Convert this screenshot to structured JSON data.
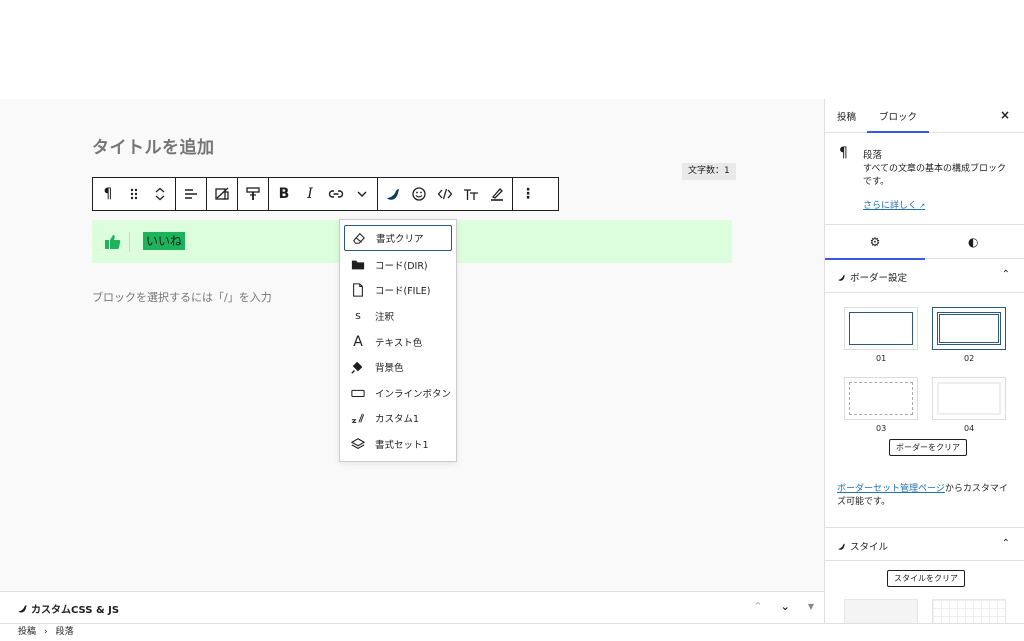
{
  "editor": {
    "title_placeholder": "タイトルを追加",
    "word_count": "文字数：1",
    "block_text": "いいね",
    "paragraph_placeholder": "ブロックを選択するには「/」を入力"
  },
  "toolbar": {
    "icons": [
      "paragraph-icon",
      "drag-handle-icon",
      "move-up-down-icon",
      "align-icon",
      "image-toggle-icon",
      "paint-roller-icon",
      "bold-icon",
      "italic-icon",
      "link-icon",
      "chevron-down-icon",
      "brand-icon",
      "emoji-icon",
      "code-icon",
      "text-size-icon",
      "highlighter-icon",
      "more-options-icon"
    ],
    "bold_label": "B",
    "italic_label": "I",
    "more_label": "⋮"
  },
  "format_menu": {
    "items": [
      {
        "label": "書式クリア",
        "icon": "eraser-icon"
      },
      {
        "label": "コード(DIR)",
        "icon": "folder-icon"
      },
      {
        "label": "コード(FILE)",
        "icon": "file-icon"
      },
      {
        "label": "注釈",
        "icon": "s-icon"
      },
      {
        "label": "テキスト色",
        "icon": "text-color-icon"
      },
      {
        "label": "背景色",
        "icon": "fill-icon"
      },
      {
        "label": "インラインボタン",
        "icon": "button-icon"
      },
      {
        "label": "カスタム1",
        "icon": "custom-icon"
      },
      {
        "label": "書式セット1",
        "icon": "layers-icon"
      }
    ],
    "s_glyph": "s",
    "a_glyph": "A"
  },
  "bottom_panel": {
    "title": "カスタムCSS & JS"
  },
  "breadcrumb": {
    "items": [
      "投稿",
      "段落"
    ],
    "separator": "›"
  },
  "sidebar": {
    "tabs": [
      "投稿",
      "ブロック"
    ],
    "close_label": "×",
    "block_card": {
      "title": "段落",
      "description": "すべての文章の基本の構成ブロックです。",
      "link": "さらに詳しく"
    },
    "border_section": {
      "title": "ボーダー設定",
      "swatches": [
        "01",
        "02",
        "03",
        "04"
      ],
      "clear_button": "ボーダーをクリア",
      "note_link": "ボーダーセット管理ページ",
      "note_text": "からカスタマイズ可能です。"
    },
    "style_section": {
      "title": "スタイル",
      "clear_button": "スタイルをクリア"
    }
  },
  "colors": {
    "accent": "#3858e9",
    "block_bg": "#dcfedc",
    "highlight": "#1db35a",
    "link": "#2271b1",
    "thumb": "#1db35a"
  }
}
